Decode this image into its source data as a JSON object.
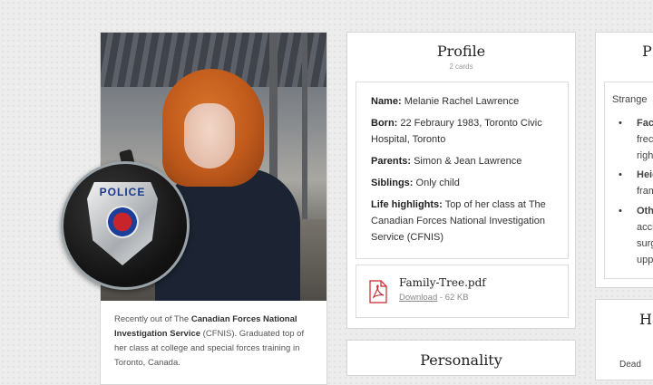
{
  "character": {
    "badge_word": "POLICE",
    "description_pre": "Recently out of The ",
    "description_bold": "Canadian Forces National Investigation Service",
    "description_post": " (CFNIS). Graduated top of her class at college and special forces training in Toronto, Canada."
  },
  "profile": {
    "title": "Profile",
    "subtitle": "2 cards",
    "fields": [
      {
        "label": "Name:",
        "value": "Melanie Rachel Lawrence"
      },
      {
        "label": "Born:",
        "value": "22 Febraury 1983, Toronto Civic Hospital, Toronto"
      },
      {
        "label": "Parents:",
        "value": "Simon & Jean Lawrence"
      },
      {
        "label": "Siblings:",
        "value": "Only child"
      },
      {
        "label": "Life highlights:",
        "value": "Top of her class at The Canadian Forces National Investigation Service (CFNIS)"
      }
    ],
    "file": {
      "name": "Family-Tree.pdf",
      "download_label": "Download",
      "size": " - 62 KB",
      "icon": "pdf-icon"
    }
  },
  "personality": {
    "title": "Personality"
  },
  "right_panel": {
    "title": "P",
    "lines": [
      "Strange",
      "Face",
      "frec",
      "righ",
      "Heig",
      "fram",
      "Oth",
      "acci",
      "surg",
      "upp"
    ],
    "title2": "Ha",
    "line2": "Dead"
  },
  "colors": {
    "accent_pdf": "#c8242b",
    "badge_blue": "#1a3a8a"
  }
}
